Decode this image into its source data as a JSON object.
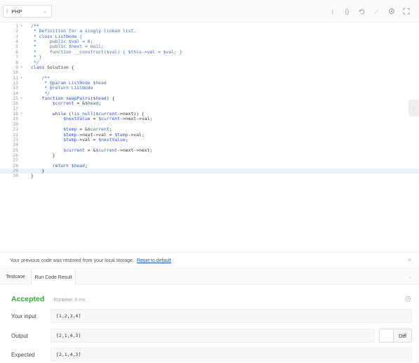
{
  "toolbar": {
    "language": "PHP",
    "icons": [
      "info-icon",
      "braces-icon",
      "undo-icon",
      "shortcut-icon",
      "settings-icon",
      "fullscreen-icon"
    ]
  },
  "editor": {
    "lines": [
      {
        "n": "1",
        "fold": "▾",
        "t": "/**"
      },
      {
        "n": "2",
        "fold": "",
        "t": " * Definition for a singly-linked list."
      },
      {
        "n": "3",
        "fold": "",
        "t": " * class ListNode {"
      },
      {
        "n": "4",
        "fold": "",
        "t": " *     public $val = 0;"
      },
      {
        "n": "5",
        "fold": "",
        "t": " *     public $next = null;"
      },
      {
        "n": "6",
        "fold": "",
        "t": " *     function __construct($val) { $this->val = $val; }"
      },
      {
        "n": "7",
        "fold": "",
        "t": " * }"
      },
      {
        "n": "8",
        "fold": "",
        "t": " */"
      },
      {
        "n": "9",
        "fold": "▾",
        "t": "class Solution {"
      },
      {
        "n": "10",
        "fold": "",
        "t": ""
      },
      {
        "n": "11",
        "fold": "▾",
        "t": "    /**"
      },
      {
        "n": "12",
        "fold": "",
        "t": "     * @param ListNode $head"
      },
      {
        "n": "13",
        "fold": "",
        "t": "     * @return ListNode"
      },
      {
        "n": "14",
        "fold": "",
        "t": "     */"
      },
      {
        "n": "15",
        "fold": "▾",
        "t": "    function swapPairs($head) {"
      },
      {
        "n": "16",
        "fold": "",
        "t": "        $current = &$head;"
      },
      {
        "n": "17",
        "fold": "",
        "t": ""
      },
      {
        "n": "18",
        "fold": "▾",
        "t": "        while (!is_null($current->next)) {"
      },
      {
        "n": "19",
        "fold": "",
        "t": "            $nextValue = $current->next->val;"
      },
      {
        "n": "20",
        "fold": "",
        "t": ""
      },
      {
        "n": "21",
        "fold": "",
        "t": "            $temp = &$current;"
      },
      {
        "n": "22",
        "fold": "",
        "t": "            $temp->next->val = $temp->val;"
      },
      {
        "n": "23",
        "fold": "",
        "t": "            $temp->val = $nextValue;"
      },
      {
        "n": "24",
        "fold": "",
        "t": ""
      },
      {
        "n": "25",
        "fold": "",
        "t": "            $current = &$current->next->next;"
      },
      {
        "n": "26",
        "fold": "",
        "t": "        }"
      },
      {
        "n": "27",
        "fold": "",
        "t": ""
      },
      {
        "n": "28",
        "fold": "",
        "t": "        return $head;"
      },
      {
        "n": "29",
        "fold": "",
        "t": "    }"
      },
      {
        "n": "30",
        "fold": "",
        "t": "}"
      }
    ],
    "active_line": 29
  },
  "restore_bar": {
    "message": "Your previous code was restored from your local storage.",
    "reset_link": "Reset to default"
  },
  "tabs": [
    "Testcase",
    "Run Code Result"
  ],
  "result": {
    "status": "Accepted",
    "status_color": "#43a047",
    "runtime": "Runtime: 8 ms",
    "rows": [
      {
        "label": "Your input",
        "value": "[1,2,3,4]"
      },
      {
        "label": "Output",
        "value": "[2,1,4,3]"
      },
      {
        "label": "Expected",
        "value": "[2,1,4,3]"
      }
    ],
    "diff_label": "Diff"
  }
}
